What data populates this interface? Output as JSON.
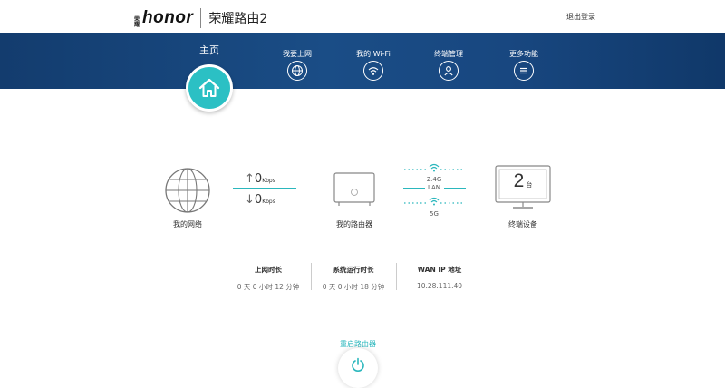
{
  "header": {
    "brand_mark": "荣耀",
    "brand_name": "honor",
    "product_title": "荣耀路由2",
    "logout_label": "退出登录"
  },
  "nav": {
    "home_label": "主页",
    "items": [
      {
        "label": "我要上网",
        "icon": "globe-icon"
      },
      {
        "label": "我的 Wi-Fi",
        "icon": "wifi-icon"
      },
      {
        "label": "终端管理",
        "icon": "user-icon"
      },
      {
        "label": "更多功能",
        "icon": "menu-icon"
      }
    ],
    "colors": {
      "band": "#1a4d86",
      "home_accent": "#2bc0c4"
    }
  },
  "topology": {
    "internet_label": "我的网络",
    "upload_speed": "0",
    "download_speed": "0",
    "speed_unit": "Kbps",
    "router_label": "我的路由器",
    "band_24": "2.4G",
    "lan_label": "LAN",
    "band_5": "5G",
    "device_count": "2",
    "device_unit": "台",
    "devices_label": "终端设备"
  },
  "status": {
    "online_time_label": "上网时长",
    "online_time_value": "0 天 0 小时 12 分钟",
    "uptime_label": "系统运行时长",
    "uptime_value": "0 天 0 小时 18 分钟",
    "wan_ip_label": "WAN IP 地址",
    "wan_ip_value": "10.28.111.40"
  },
  "actions": {
    "reboot_label": "重启路由器",
    "accent": "#2bb7bd"
  }
}
